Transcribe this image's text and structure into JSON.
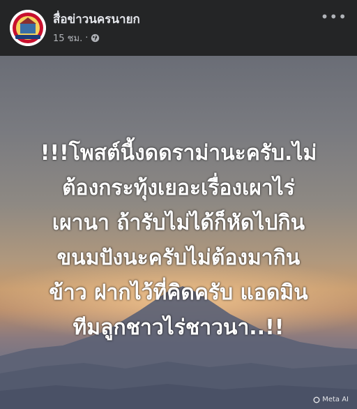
{
  "post": {
    "page_name": "สื่อข่าวนครนายก",
    "time": "15 ชม.",
    "privacy_icon": "globe-icon",
    "more_icon": "more-dots-icon"
  },
  "image": {
    "caption_lines": [
      "!!!โพสต์นี้งดดราม่านะครับ.ไม่",
      "ต้องกระทุ้งเยอะเรื่องเผาไร่",
      "เผานา ถ้ารับไม่ได้ก็หัดไปกิน",
      "ขนมปังนะครับไม่ต้องมากิน",
      "ข้าว ฝากไว้ที่คิดครับ แอดมิน",
      "ทีมลูกชาวไร่ชาวนา..!!"
    ],
    "watermark": "Meta AI",
    "colors": {
      "sky_top": "#6a6d76",
      "sunset_glow": "#c59a6e",
      "mountain": "#5c6275"
    }
  }
}
